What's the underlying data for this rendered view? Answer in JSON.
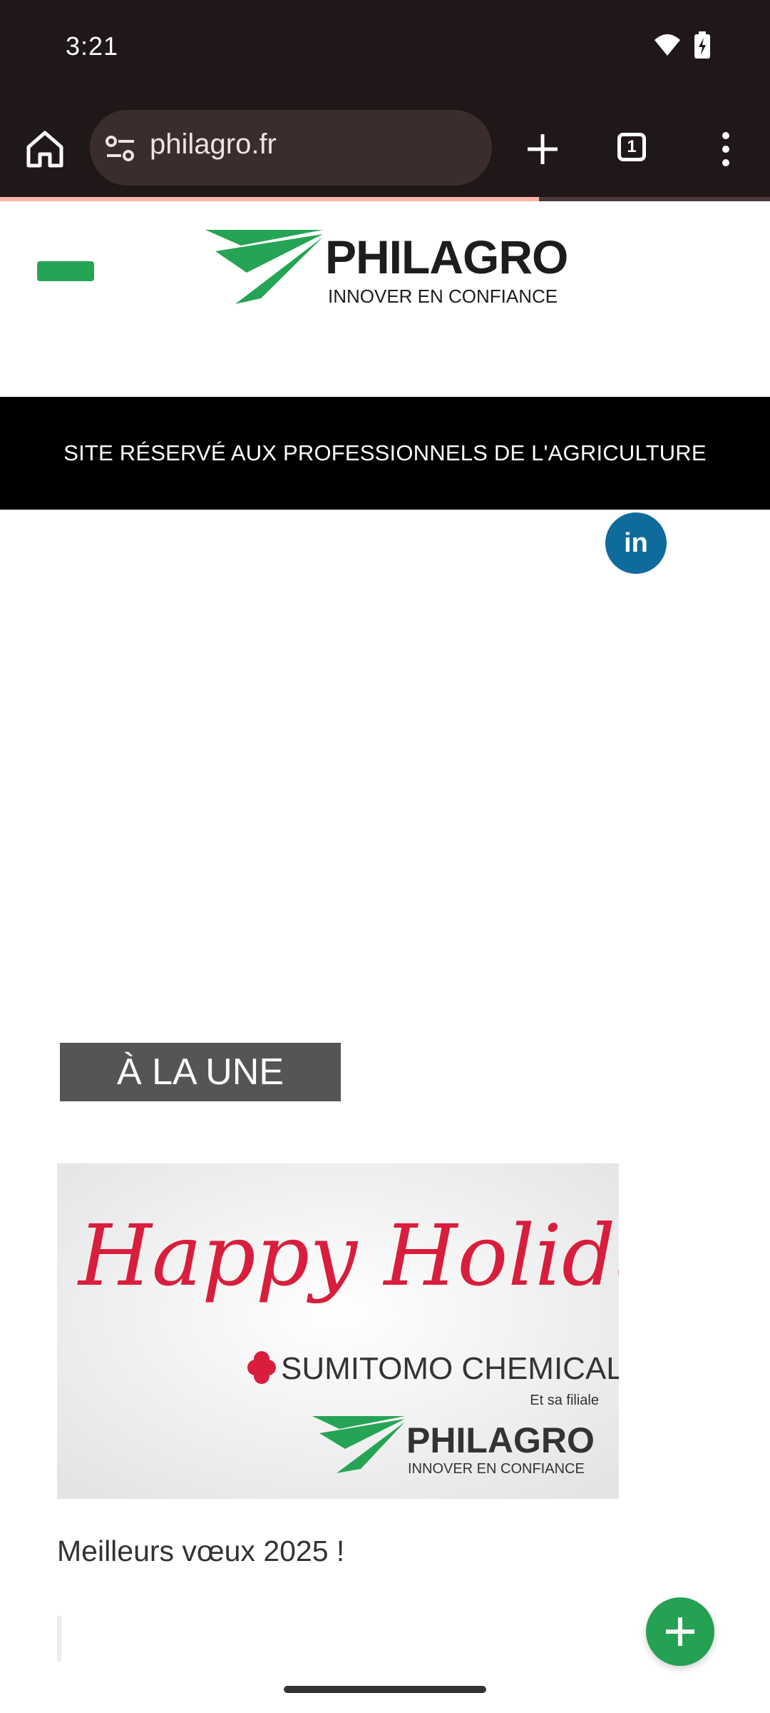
{
  "status_bar": {
    "time": "3:21"
  },
  "browser": {
    "url": "philagro.fr",
    "tab_count": "1",
    "load_progress": 0.7
  },
  "site": {
    "logo": {
      "name": "PHILAGRO",
      "tagline": "INNOVER EN CONFIANCE"
    },
    "banner": "SITE RÉSERVÉ AUX PROFESSIONNELS DE L'AGRICULTURE",
    "social": {
      "linkedin_label": "in"
    },
    "featured": {
      "heading": "À LA UNE",
      "card": {
        "image_script_text": "Happy Holiday",
        "image_company": "SUMITOMO CHEMICAL",
        "image_subsidiary": "Et sa filiale",
        "image_logo_name": "PHILAGRO",
        "image_logo_tagline": "INNOVER EN CONFIANCE",
        "title": "Meilleurs vœux 2025 !"
      }
    }
  },
  "colors": {
    "browser_chrome": "#201718",
    "brand_green": "#25a455",
    "linkedin_blue": "#0f6b9c",
    "banner_black": "#000000",
    "holiday_red": "#d81e3c"
  },
  "icons": {
    "home": "home-icon",
    "tune": "tune-icon",
    "new_tab": "plus-icon",
    "tabs": "tab-switcher-icon",
    "menu": "more-vert-icon",
    "fab": "plus-icon"
  }
}
